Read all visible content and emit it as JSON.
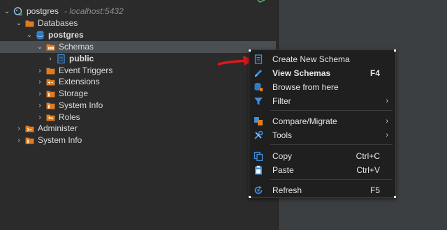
{
  "tree": {
    "connection": {
      "name": "postgres",
      "host": "- localhost:5432"
    },
    "databases_label": "Databases",
    "database_name": "postgres",
    "schemas_label": "Schemas",
    "schema_public": "public",
    "event_triggers": "Event Triggers",
    "extensions": "Extensions",
    "storage": "Storage",
    "system_info_db": "System Info",
    "roles": "Roles",
    "administer": "Administer",
    "system_info_root": "System Info"
  },
  "context_menu": {
    "create_new_schema": "Create New Schema",
    "view_schemas": "View Schemas",
    "view_schemas_shortcut": "F4",
    "browse_from_here": "Browse from here",
    "filter": "Filter",
    "compare_migrate": "Compare/Migrate",
    "tools": "Tools",
    "copy": "Copy",
    "copy_shortcut": "Ctrl+C",
    "paste": "Paste",
    "paste_shortcut": "Ctrl+V",
    "refresh": "Refresh",
    "refresh_shortcut": "F5",
    "submenu_arrow": "›"
  },
  "icons": {
    "chevron_down": "⌄",
    "chevron_right": "›"
  },
  "colors": {
    "folder": "#e07b22",
    "db": "#3c8fd6",
    "accent_blue": "#3d8fe0",
    "annotation_red": "#e01818"
  }
}
